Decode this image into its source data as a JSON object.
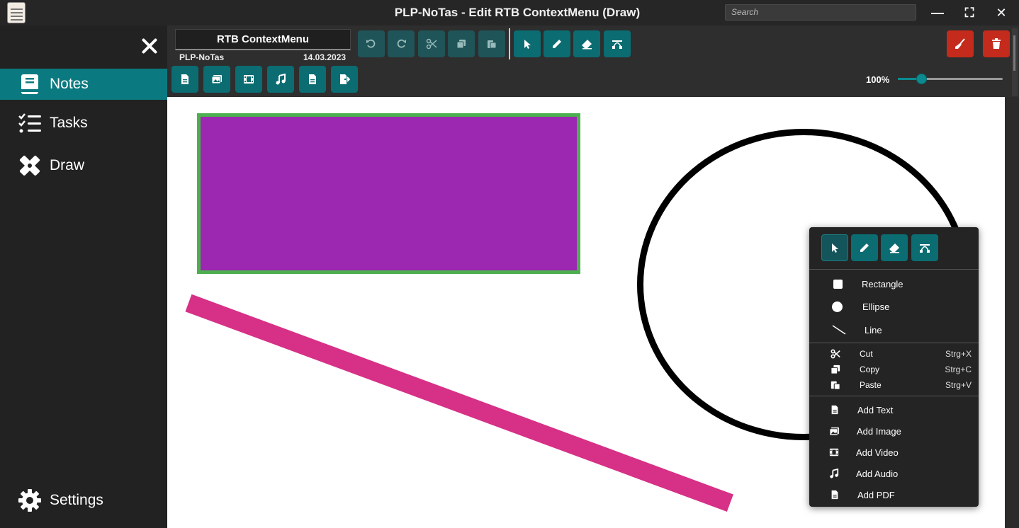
{
  "window": {
    "title": "PLP-NoTas - Edit RTB ContextMenu (Draw)",
    "search_placeholder": "Search"
  },
  "sidebar": {
    "items": [
      {
        "label": "Notes",
        "icon": "book-icon"
      },
      {
        "label": "Tasks",
        "icon": "checklist-icon"
      },
      {
        "label": "Draw",
        "icon": "pencil-ruler-icon"
      }
    ],
    "settings_label": "Settings"
  },
  "note": {
    "title": "RTB ContextMenu",
    "app": "PLP-NoTas",
    "date": "14.03.2023"
  },
  "toolbar": {
    "zoom": "100%",
    "zoom_value": 0.22
  },
  "context_menu": {
    "shapes": [
      "Rectangle",
      "Ellipse",
      "Line"
    ],
    "edit": [
      {
        "label": "Cut",
        "shortcut": "Strg+X"
      },
      {
        "label": "Copy",
        "shortcut": "Strg+C"
      },
      {
        "label": "Paste",
        "shortcut": "Strg+V"
      }
    ],
    "add": [
      "Add Text",
      "Add Image",
      "Add Video",
      "Add Audio",
      "Add PDF"
    ]
  },
  "colors": {
    "accent": "#0b7a80",
    "rect_fill": "#9c27b0",
    "rect_stroke": "#4caf50",
    "line": "#d63087",
    "danger": "#c42b1c"
  }
}
